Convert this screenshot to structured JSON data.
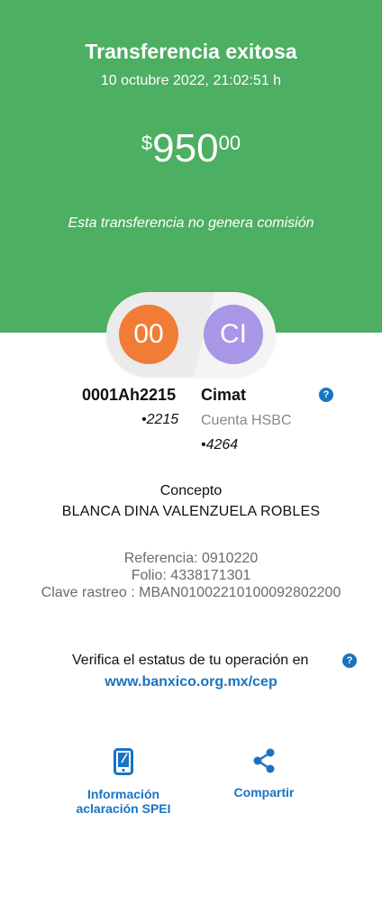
{
  "header": {
    "title": "Transferencia exitosa",
    "datetime": "10 octubre 2022, 21:02:51 h",
    "amount": {
      "currency": "$",
      "integer": "950",
      "decimals": "00"
    },
    "commission_note": "Esta transferencia no genera comisión"
  },
  "origin": {
    "initials": "00",
    "name": "0001Ah2215",
    "account_last": "•2215"
  },
  "destination": {
    "initials": "CI",
    "name": "Cimat",
    "bank": "Cuenta HSBC",
    "account_last": "•4264"
  },
  "help_glyph": "?",
  "concept": {
    "label": "Concepto",
    "value": "BLANCA DINA VALENZUELA ROBLES"
  },
  "details": {
    "reference": "Referencia: 0910220",
    "folio": "Folio: 4338171301",
    "tracking_key": "Clave rastreo : MBAN01002210100092802200"
  },
  "verify": {
    "text": "Verifica el estatus de tu operación en",
    "link": "www.banxico.org.mx/cep"
  },
  "actions": {
    "info_line1": "Información",
    "info_line2": "aclaración SPEI",
    "share": "Compartir"
  },
  "colors": {
    "header_green": "#4caf62",
    "origin_orange": "#f07c35",
    "dest_purple": "#a896e6",
    "accent_blue": "#1a73c2"
  },
  "icons": {
    "info": "phone-icon",
    "share": "share-icon",
    "help": "help-icon"
  }
}
